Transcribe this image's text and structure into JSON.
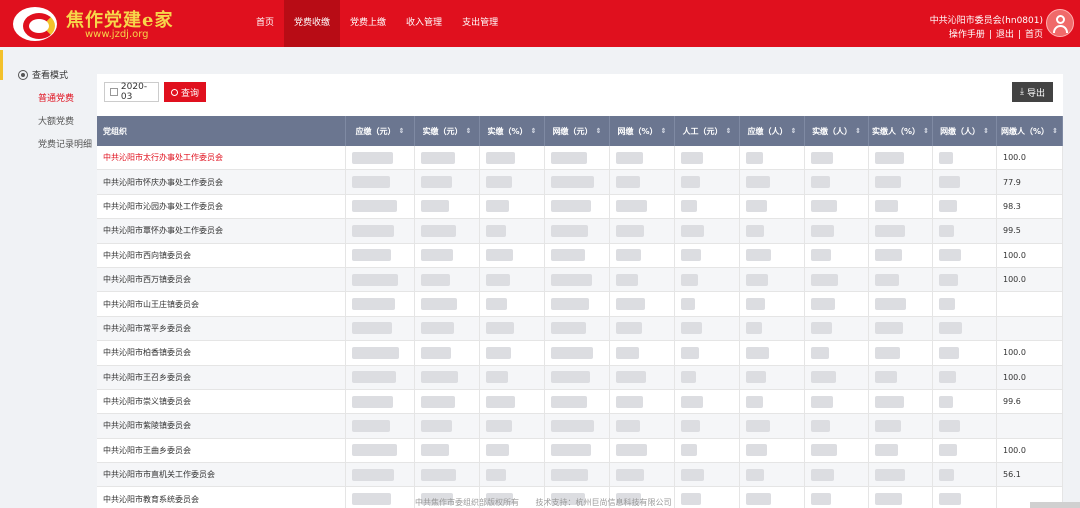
{
  "header": {
    "logo_title": "焦作党建e家",
    "logo_url": "www.jzdj.org",
    "nav": [
      "首页",
      "党费收缴",
      "党费上缴",
      "收入管理",
      "支出管理"
    ],
    "nav_active": 1,
    "user_name": "中共沁阳市委员会(hn0801)",
    "links": {
      "manual": "操作手册",
      "logout": "退出",
      "home": "首页",
      "sep": "|"
    }
  },
  "sidebar": {
    "title": "查看模式",
    "items": [
      "普通党费",
      "大额党费",
      "党费记录明细"
    ],
    "active": 0
  },
  "toolbar": {
    "date_value": "2020-03",
    "search_label": "查询",
    "export_label": "导出"
  },
  "table": {
    "columns": [
      "党组织",
      "应缴（元）",
      "实缴（元）",
      "实缴（%）",
      "网缴（元）",
      "网缴（%）",
      "人工（元）",
      "应缴（人）",
      "实缴（人）",
      "实缴人（%）",
      "网缴（人）",
      "网缴人（%）"
    ],
    "sort_glyph": "⇕",
    "rows": [
      {
        "org": "中共沁阳市太行办事处工作委员会",
        "last": "100.0"
      },
      {
        "org": "中共沁阳市怀庆办事处工作委员会",
        "last": "77.9"
      },
      {
        "org": "中共沁阳市沁园办事处工作委员会",
        "last": "98.3"
      },
      {
        "org": "中共沁阳市覃怀办事处工作委员会",
        "last": "99.5"
      },
      {
        "org": "中共沁阳市西向镇委员会",
        "last": "100.0"
      },
      {
        "org": "中共沁阳市西万镇委员会",
        "last": "100.0"
      },
      {
        "org": "中共沁阳市山王庄镇委员会",
        "last": ""
      },
      {
        "org": "中共沁阳市常平乡委员会",
        "last": ""
      },
      {
        "org": "中共沁阳市柏香镇委员会",
        "last": "100.0"
      },
      {
        "org": "中共沁阳市王召乡委员会",
        "last": "100.0"
      },
      {
        "org": "中共沁阳市崇义镇委员会",
        "last": "99.6"
      },
      {
        "org": "中共沁阳市紫陵镇委员会",
        "last": ""
      },
      {
        "org": "中共沁阳市王曲乡委员会",
        "last": "100.0"
      },
      {
        "org": "中共沁阳市市直机关工作委员会",
        "last": "56.1"
      },
      {
        "org": "中共沁阳市教育系统委员会",
        "last": ""
      }
    ],
    "active_row": 0
  },
  "footer": {
    "copyright": "中共焦作市委组织部版权所有",
    "support": "技术支持：杭州巨尚信息科技有限公司"
  }
}
